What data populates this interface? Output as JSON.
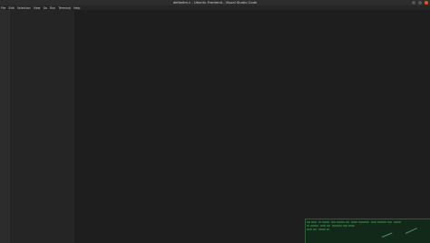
{
  "window": {
    "title": "defkeitm.c - Ubuntu Frontend - Visual Studio Code",
    "controls": [
      "minimize",
      "maximize",
      "close"
    ]
  },
  "menu": {
    "items": [
      "File",
      "Edit",
      "Selection",
      "View",
      "Go",
      "Run",
      "Terminal",
      "Help"
    ]
  },
  "colors": {
    "titlebar": "#2d2d2d",
    "menubar": "#252526",
    "activitybar": "#2c2c2c",
    "sidebar": "#252526",
    "editor": "#1e1e1e",
    "terminal_popup": "#12291a",
    "close_button": "#e95420"
  }
}
